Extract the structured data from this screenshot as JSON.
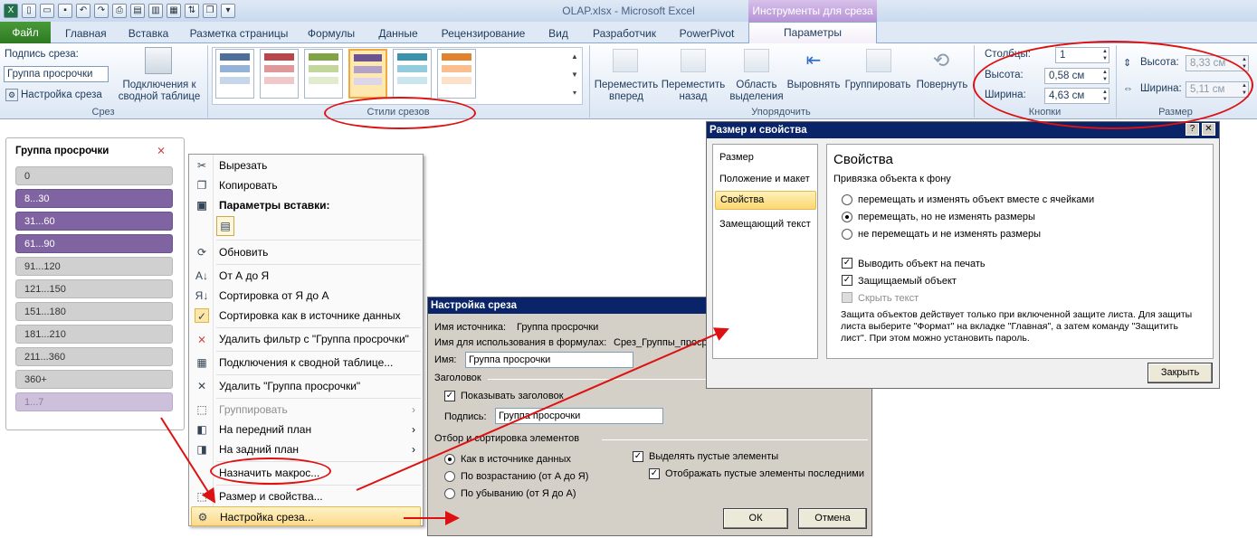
{
  "window": {
    "title": "OLAP.xlsx - Microsoft Excel",
    "context_group": "Инструменты для среза"
  },
  "tabs": {
    "file": "Файл",
    "home": "Главная",
    "insert": "Вставка",
    "layout": "Разметка страницы",
    "formulas": "Формулы",
    "data": "Данные",
    "review": "Рецензирование",
    "view": "Вид",
    "developer": "Разработчик",
    "powerpivot": "PowerPivot",
    "params": "Параметры"
  },
  "ribbon": {
    "slicer_group": {
      "caption_label": "Подпись среза:",
      "caption_value": "Группа просрочки",
      "settings": "Настройка среза",
      "connections": "Подключения к сводной таблице",
      "label": "Срез"
    },
    "styles_group": {
      "label": "Стили срезов"
    },
    "arrange_group": {
      "forward": "Переместить вперед",
      "backward": "Переместить назад",
      "selection": "Область выделения",
      "align": "Выровнять",
      "group": "Группировать",
      "rotate": "Повернуть",
      "label": "Упорядочить"
    },
    "buttons_group": {
      "columns_label": "Столбцы:",
      "columns_value": "1",
      "height_label": "Высота:",
      "height_value": "0,58 см",
      "width_label": "Ширина:",
      "width_value": "4,63 см",
      "label": "Кнопки"
    },
    "size_group": {
      "height_label": "Высота:",
      "height_value": "8,33 см",
      "width_label": "Ширина:",
      "width_value": "5,11 см",
      "label": "Размер"
    }
  },
  "slicer": {
    "title": "Группа просрочки",
    "items": [
      {
        "label": "0",
        "state": "off"
      },
      {
        "label": "8...30",
        "state": "on"
      },
      {
        "label": "31...60",
        "state": "on"
      },
      {
        "label": "61...90",
        "state": "on"
      },
      {
        "label": "91...120",
        "state": "off"
      },
      {
        "label": "121...150",
        "state": "off"
      },
      {
        "label": "151...180",
        "state": "off"
      },
      {
        "label": "181...210",
        "state": "off"
      },
      {
        "label": "211...360",
        "state": "off"
      },
      {
        "label": "360+",
        "state": "off"
      },
      {
        "label": "1...7",
        "state": "nodata"
      }
    ]
  },
  "context_menu": {
    "cut": "Вырезать",
    "copy": "Копировать",
    "paste_options": "Параметры вставки:",
    "refresh": "Обновить",
    "sort_az": "От А до Я",
    "sort_za": "Сортировка от Я до А",
    "sort_source": "Сортировка как в источнике данных",
    "clear_filter": "Удалить фильтр с \"Группа просрочки\"",
    "pivot_connections": "Подключения к сводной таблице...",
    "delete": "Удалить \"Группа просрочки\"",
    "group": "Группировать",
    "bring_forward": "На передний план",
    "send_back": "На задний план",
    "assign_macro": "Назначить макрос...",
    "size_props": "Размер и свойства...",
    "slicer_settings": "Настройка среза..."
  },
  "slicer_dialog": {
    "title": "Настройка среза",
    "source_label": "Имя источника:",
    "source_value": "Группа просрочки",
    "formula_label": "Имя для использования в формулах:",
    "formula_value": "Срез_Группы_проср",
    "name_label": "Имя:",
    "name_value": "Группа просрочки",
    "header_section": "Заголовок",
    "show_header": "Показывать заголовок",
    "caption_label": "Подпись:",
    "caption_value": "Группа просрочки",
    "sort_section": "Отбор и сортировка элементов",
    "sort_source": "Как в источнике данных",
    "sort_asc": "По возрастанию (от А до Я)",
    "sort_desc": "По убыванию (от Я до А)",
    "hide_empty": "Выделять пустые элементы",
    "empty_last": "Отображать пустые элементы последними",
    "ok": "ОК",
    "cancel": "Отмена"
  },
  "size_dialog": {
    "title": "Размер и свойства",
    "nav": [
      "Размер",
      "Положение и макет",
      "Свойства",
      "Замещающий текст"
    ],
    "heading": "Свойства",
    "anchor_section": "Привязка объекта к фону",
    "opt_move_size": "перемещать и изменять объект вместе с ячейками",
    "opt_move": "перемещать, но не изменять размеры",
    "opt_none": "не перемещать и не изменять размеры",
    "print_obj": "Выводить объект на печать",
    "locked": "Защищаемый объект",
    "hide_text": "Скрыть текст",
    "note": "Защита объектов действует только при включенной защите листа. Для защиты листа выберите \"Формат\" на вкладке \"Главная\", а затем команду \"Защитить лист\". При этом можно установить пароль.",
    "close": "Закрыть"
  }
}
